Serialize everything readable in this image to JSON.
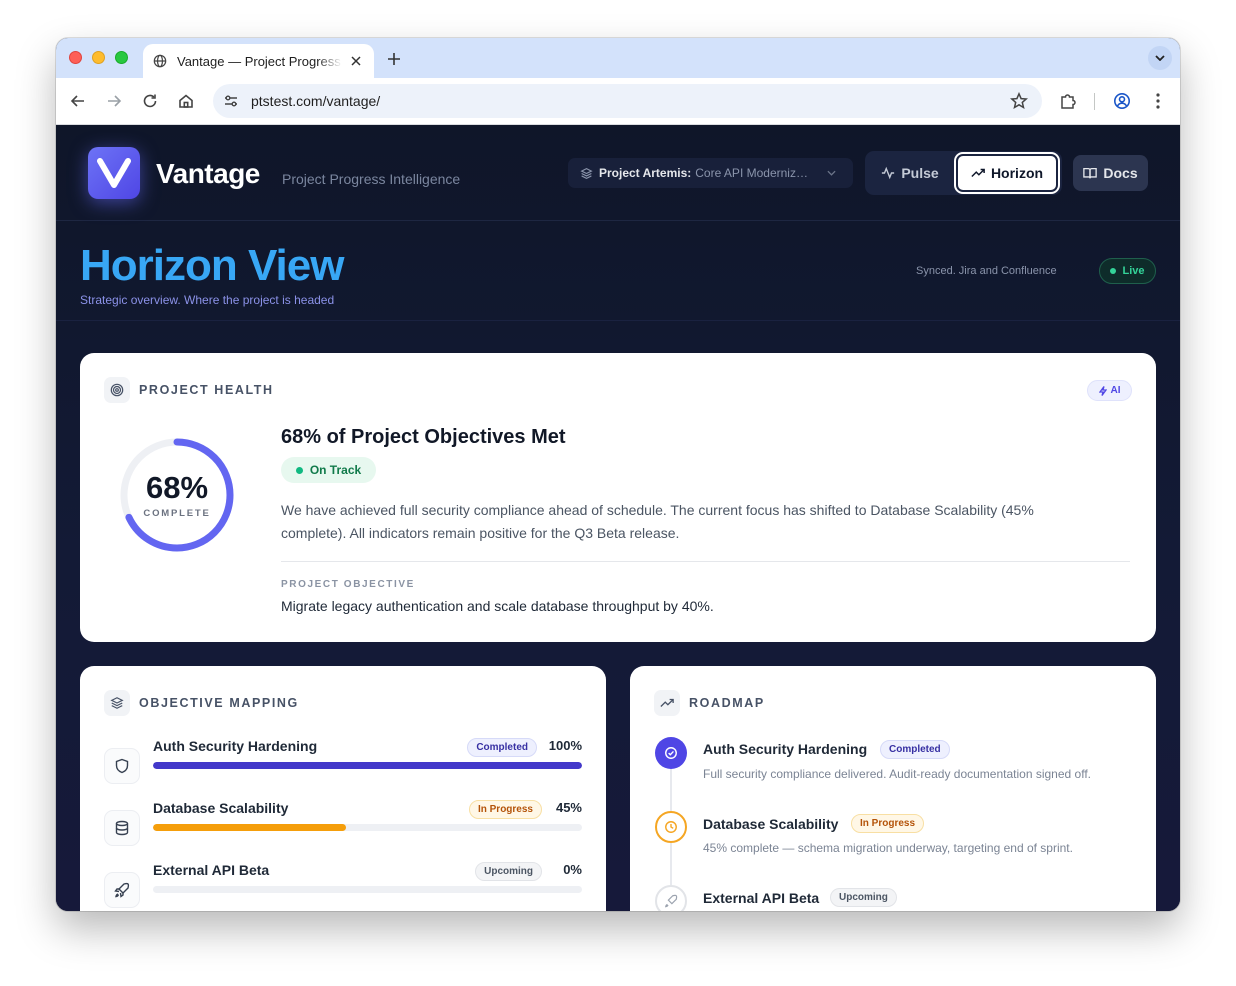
{
  "browser": {
    "tab_title": "Vantage — Project Progress Intelligence",
    "url": "ptstest.com/vantage/"
  },
  "header": {
    "brand": "Vantage",
    "tagline": "Project Progress Intelligence",
    "project_name": "Project Artemis:",
    "project_desc": "Core API Modernization",
    "nav": {
      "pulse": "Pulse",
      "horizon": "Horizon",
      "docs": "Docs"
    }
  },
  "hero": {
    "title": "Horizon View",
    "subtitle": "Strategic overview. Where the project is headed",
    "sync_text": "Synced. Jira and Confluence",
    "live_label": "Live"
  },
  "health": {
    "section_title": "PROJECT HEALTH",
    "ai_badge": "AI",
    "percent": 68,
    "percent_label": "68%",
    "complete_label": "COMPLETE",
    "headline": "68% of Project Objectives Met",
    "status": "On Track",
    "summary": "We have achieved full security compliance ahead of schedule. The current focus has shifted to Database Scalability (45% complete). All indicators remain positive for the Q3 Beta release.",
    "objective_label": "PROJECT OBJECTIVE",
    "objective": "Migrate legacy authentication and scale database throughput by 40%."
  },
  "mapping": {
    "section_title": "OBJECTIVE MAPPING",
    "items": [
      {
        "name": "Auth Security Hardening",
        "status": "Completed",
        "percent": 100,
        "percent_label": "100%",
        "icon": "shield-icon",
        "color": "#4338ca"
      },
      {
        "name": "Database Scalability",
        "status": "In Progress",
        "percent": 45,
        "percent_label": "45%",
        "icon": "database-icon",
        "color": "#f59e0b"
      },
      {
        "name": "External API Beta",
        "status": "Upcoming",
        "percent": 0,
        "percent_label": "0%",
        "icon": "rocket-icon",
        "color": "#cbd5e1"
      }
    ]
  },
  "roadmap": {
    "section_title": "ROADMAP",
    "items": [
      {
        "name": "Auth Security Hardening",
        "status": "Completed",
        "desc": "Full security compliance delivered. Audit-ready documentation signed off.",
        "icon": "check-circle-icon"
      },
      {
        "name": "Database Scalability",
        "status": "In Progress",
        "desc": "45% complete — schema migration underway, targeting end of sprint.",
        "icon": "clock-icon"
      },
      {
        "name": "External API Beta",
        "status": "Upcoming",
        "icon": "rocket-icon"
      }
    ]
  },
  "colors": {
    "accent": "#4f46e5",
    "ring": "#6366f1",
    "hero_title": "#38a7f5",
    "on_track": "#10b981",
    "in_progress": "#f59e0b"
  }
}
